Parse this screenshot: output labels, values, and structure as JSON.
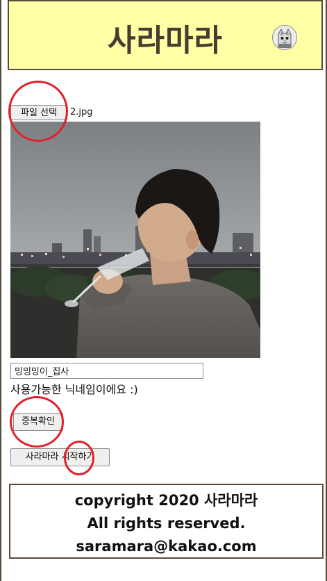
{
  "header": {
    "title": "사라마라"
  },
  "upload": {
    "file_button_label": "파일 선택",
    "file_name": "2.jpg"
  },
  "nickname": {
    "value": "밍밍밍이_집사",
    "status_message": "사용가능한 닉네임이에요 :)"
  },
  "buttons": {
    "check_duplicate_label": "중복확인",
    "start_label": "사라마라 시작하기"
  },
  "footer": {
    "line1": "copyright 2020 사라마라",
    "line2": "All rights reserved.",
    "line3": "saramara@kakao.com"
  },
  "colors": {
    "header_bg": "#ffffa6",
    "border": "#5a4a3c",
    "highlight_ring": "#e0202a"
  }
}
